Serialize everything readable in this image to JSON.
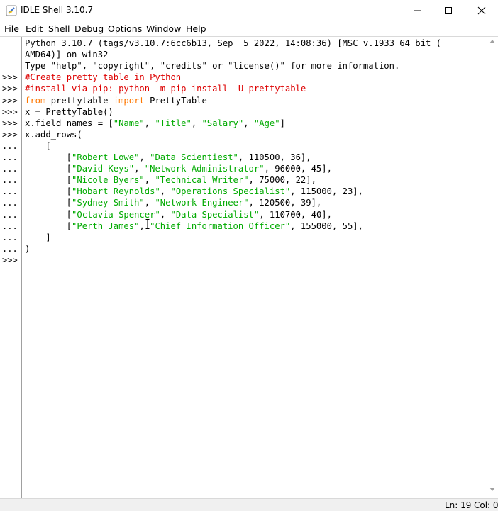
{
  "window": {
    "title": "IDLE Shell 3.10.7"
  },
  "menu": [
    {
      "label": "File",
      "underline": "F",
      "rest": "ile"
    },
    {
      "label": "Edit",
      "underline": "E",
      "rest": "dit"
    },
    {
      "label": "Shell",
      "underline": "",
      "rest": "Shell"
    },
    {
      "label": "Debug",
      "underline": "D",
      "rest": "ebug"
    },
    {
      "label": "Options",
      "underline": "O",
      "rest": "ptions"
    },
    {
      "label": "Window",
      "underline": "W",
      "rest": "indow"
    },
    {
      "label": "Help",
      "underline": "H",
      "rest": "elp"
    }
  ],
  "shell": {
    "lines": [
      {
        "prompt": "",
        "segments": [
          {
            "t": "Python 3.10.7 (tags/v3.10.7:6cc6b13, Sep  5 2022, 14:08:36) [MSC v.1933 64 bit (",
            "c": ""
          }
        ]
      },
      {
        "prompt": "",
        "segments": [
          {
            "t": "AMD64)] on win32",
            "c": ""
          }
        ]
      },
      {
        "prompt": "",
        "segments": [
          {
            "t": "Type \"help\", \"copyright\", \"credits\" or \"license()\" for more information.",
            "c": ""
          }
        ]
      },
      {
        "prompt": ">>>",
        "segments": [
          {
            "t": "#Create pretty table in Python",
            "c": "comment"
          }
        ]
      },
      {
        "prompt": ">>>",
        "segments": [
          {
            "t": "#install via pip: python -m pip install -U prettytable",
            "c": "comment"
          }
        ]
      },
      {
        "prompt": ">>>",
        "segments": [
          {
            "t": "from",
            "c": "kw"
          },
          {
            "t": " prettytable ",
            "c": ""
          },
          {
            "t": "import",
            "c": "kw"
          },
          {
            "t": " PrettyTable",
            "c": ""
          }
        ]
      },
      {
        "prompt": ">>>",
        "segments": [
          {
            "t": "x = PrettyTable()",
            "c": ""
          }
        ]
      },
      {
        "prompt": ">>>",
        "segments": [
          {
            "t": "x.field_names = [",
            "c": ""
          },
          {
            "t": "\"Name\"",
            "c": "str"
          },
          {
            "t": ", ",
            "c": ""
          },
          {
            "t": "\"Title\"",
            "c": "str"
          },
          {
            "t": ", ",
            "c": ""
          },
          {
            "t": "\"Salary\"",
            "c": "str"
          },
          {
            "t": ", ",
            "c": ""
          },
          {
            "t": "\"Age\"",
            "c": "str"
          },
          {
            "t": "]",
            "c": ""
          }
        ]
      },
      {
        "prompt": ">>>",
        "segments": [
          {
            "t": "x.add_rows(",
            "c": ""
          }
        ]
      },
      {
        "prompt": "...",
        "segments": [
          {
            "t": "    [",
            "c": ""
          }
        ]
      },
      {
        "prompt": "...",
        "segments": [
          {
            "t": "        [",
            "c": ""
          },
          {
            "t": "\"Robert Lowe\"",
            "c": "str"
          },
          {
            "t": ", ",
            "c": ""
          },
          {
            "t": "\"Data Scientiest\"",
            "c": "str"
          },
          {
            "t": ", 110500, 36],",
            "c": ""
          }
        ]
      },
      {
        "prompt": "...",
        "segments": [
          {
            "t": "        [",
            "c": ""
          },
          {
            "t": "\"David Keys\"",
            "c": "str"
          },
          {
            "t": ", ",
            "c": ""
          },
          {
            "t": "\"Network Administrator\"",
            "c": "str"
          },
          {
            "t": ", 96000, 45],",
            "c": ""
          }
        ]
      },
      {
        "prompt": "...",
        "segments": [
          {
            "t": "        [",
            "c": ""
          },
          {
            "t": "\"Nicole Byers\"",
            "c": "str"
          },
          {
            "t": ", ",
            "c": ""
          },
          {
            "t": "\"Technical Writer\"",
            "c": "str"
          },
          {
            "t": ", 75000, 22],",
            "c": ""
          }
        ]
      },
      {
        "prompt": "...",
        "segments": [
          {
            "t": "        [",
            "c": ""
          },
          {
            "t": "\"Hobart Reynolds\"",
            "c": "str"
          },
          {
            "t": ", ",
            "c": ""
          },
          {
            "t": "\"Operations Specialist\"",
            "c": "str"
          },
          {
            "t": ", 115000, 23],",
            "c": ""
          }
        ]
      },
      {
        "prompt": "...",
        "segments": [
          {
            "t": "        [",
            "c": ""
          },
          {
            "t": "\"Sydney Smith\"",
            "c": "str"
          },
          {
            "t": ", ",
            "c": ""
          },
          {
            "t": "\"Network Engineer\"",
            "c": "str"
          },
          {
            "t": ", 120500, 39],",
            "c": ""
          }
        ]
      },
      {
        "prompt": "...",
        "segments": [
          {
            "t": "        [",
            "c": ""
          },
          {
            "t": "\"Octavia Spencer\"",
            "c": "str"
          },
          {
            "t": ", ",
            "c": ""
          },
          {
            "t": "\"Data Specialist\"",
            "c": "str"
          },
          {
            "t": ", 110700, 40],",
            "c": ""
          }
        ]
      },
      {
        "prompt": "...",
        "segments": [
          {
            "t": "        [",
            "c": ""
          },
          {
            "t": "\"Perth James\"",
            "c": "str"
          },
          {
            "t": ", ",
            "c": ""
          },
          {
            "t": "\"Chief Information Officer\"",
            "c": "str"
          },
          {
            "t": ", 155000, 55],",
            "c": ""
          }
        ]
      },
      {
        "prompt": "...",
        "segments": [
          {
            "t": "    ]",
            "c": ""
          }
        ]
      },
      {
        "prompt": "...",
        "segments": [
          {
            "t": ")",
            "c": ""
          }
        ]
      },
      {
        "prompt": ">>>",
        "segments": [
          {
            "t": "",
            "c": ""
          }
        ]
      }
    ]
  },
  "status": {
    "line": "Ln: 19",
    "col": "Col: 0"
  },
  "colors": {
    "comment": "#dd0000",
    "keyword": "#ff7700",
    "string": "#00aa00"
  },
  "icons": {
    "app": "idle-feather-icon",
    "minimize": "minimize-icon",
    "maximize": "maximize-icon",
    "close": "close-icon",
    "text_cursor": "i-beam-cursor-icon"
  }
}
